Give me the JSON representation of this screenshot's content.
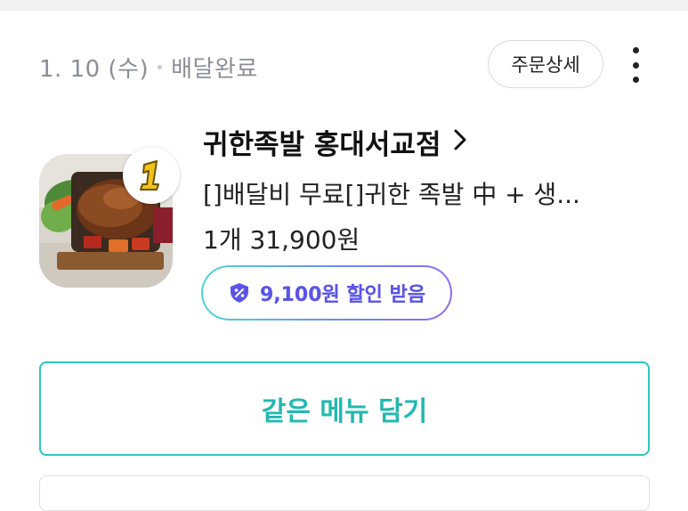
{
  "order": {
    "date": "1. 10 (수)",
    "status": "배달완료",
    "detail_label": "주문상세"
  },
  "store": {
    "name": "귀한족발 홍대서교점",
    "rank_badge": "1"
  },
  "item": {
    "description": "[]배달비 무료[]귀한 족발 中 + 생...",
    "qty_price": "1개 31,900원"
  },
  "coupon": {
    "label": "9,100원 할인 받음"
  },
  "actions": {
    "reorder_label": "같은 메뉴 담기"
  },
  "colors": {
    "accent": "#2fc6bd",
    "coupon_text": "#5b55e6",
    "muted": "#8a8f96"
  }
}
